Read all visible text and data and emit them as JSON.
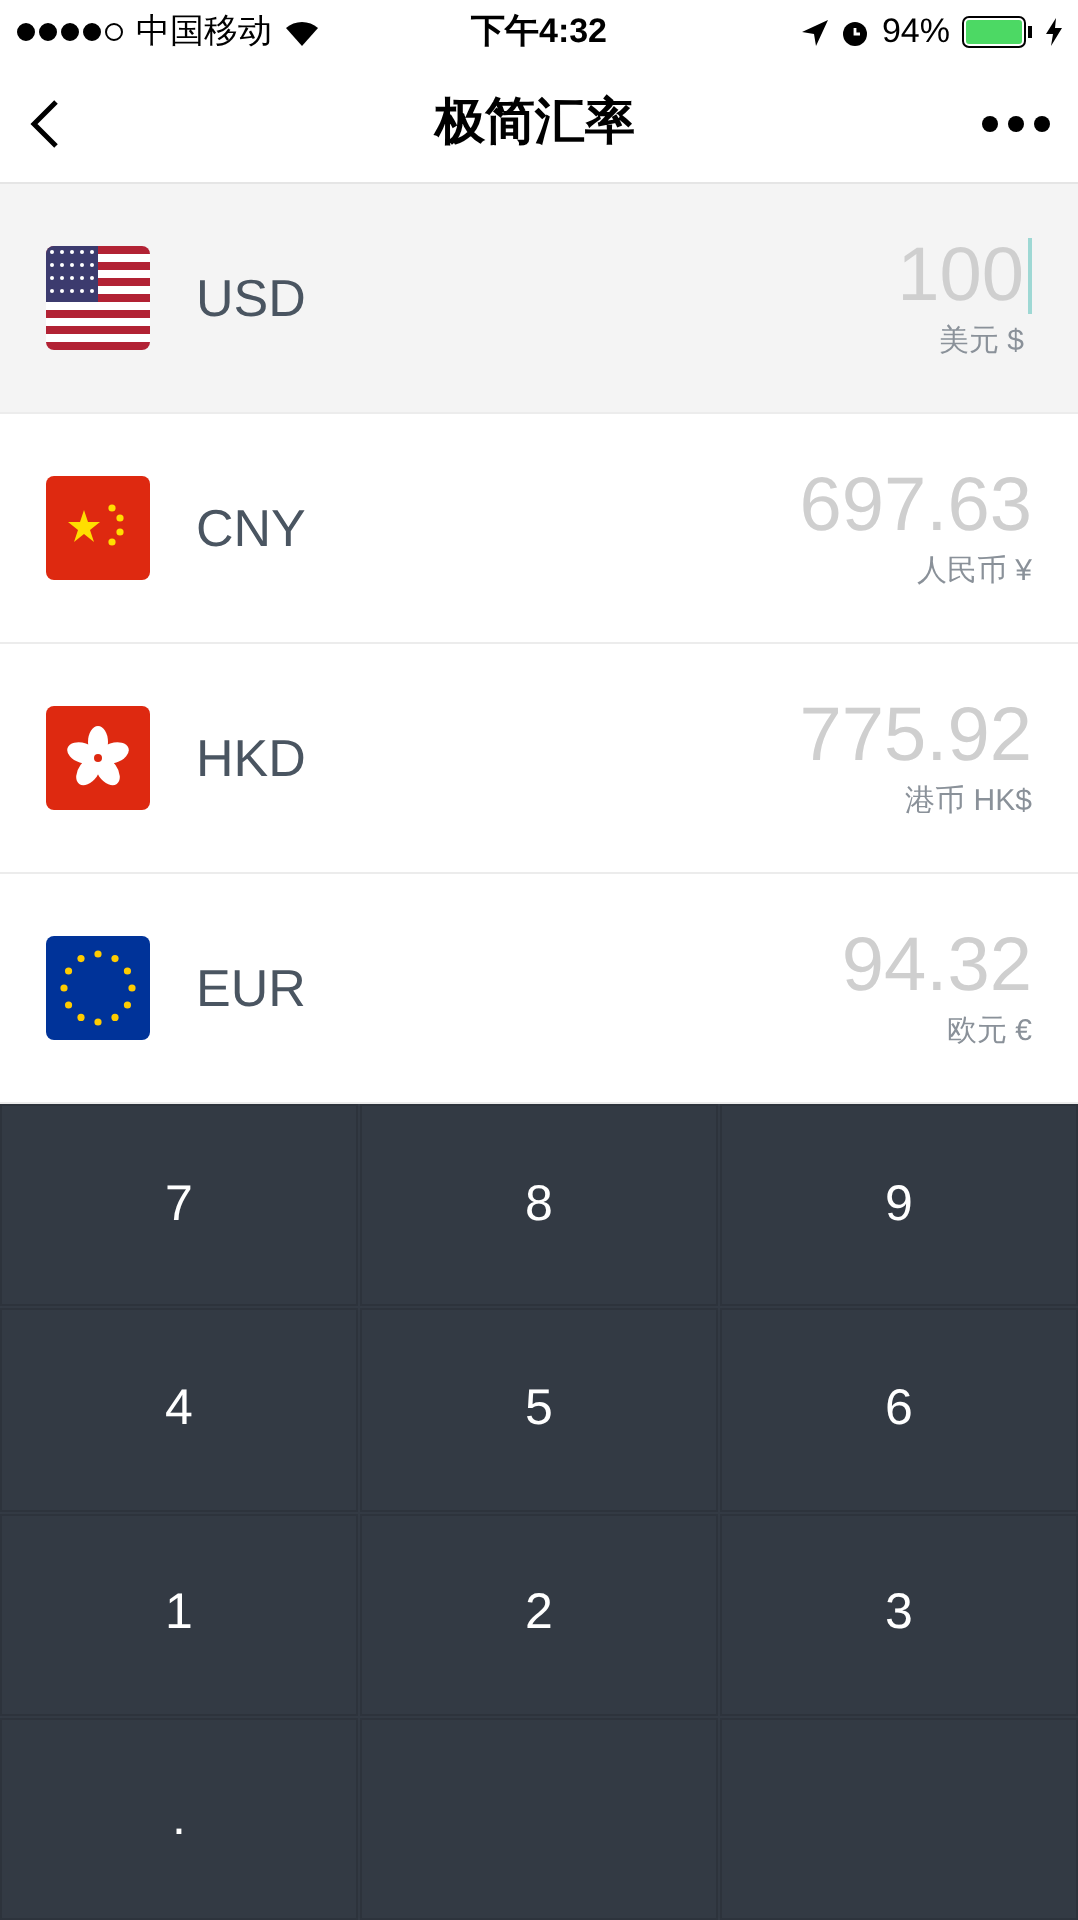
{
  "status_bar": {
    "carrier": "中国移动",
    "time": "下午4:32",
    "battery": "94%"
  },
  "nav": {
    "title": "极简汇率"
  },
  "currencies": [
    {
      "kind": "us",
      "code": "USD",
      "amount": "100",
      "name": "美元 $",
      "selected": true
    },
    {
      "kind": "cn",
      "code": "CNY",
      "amount": "697.63",
      "name": "人民币 ¥",
      "selected": false
    },
    {
      "kind": "hk",
      "code": "HKD",
      "amount": "775.92",
      "name": "港币 HK$",
      "selected": false
    },
    {
      "kind": "eu",
      "code": "EUR",
      "amount": "94.32",
      "name": "欧元 €",
      "selected": false
    }
  ],
  "keypad": {
    "keys": [
      "7",
      "8",
      "9",
      "4",
      "5",
      "6",
      "1",
      "2",
      "3",
      "."
    ]
  }
}
